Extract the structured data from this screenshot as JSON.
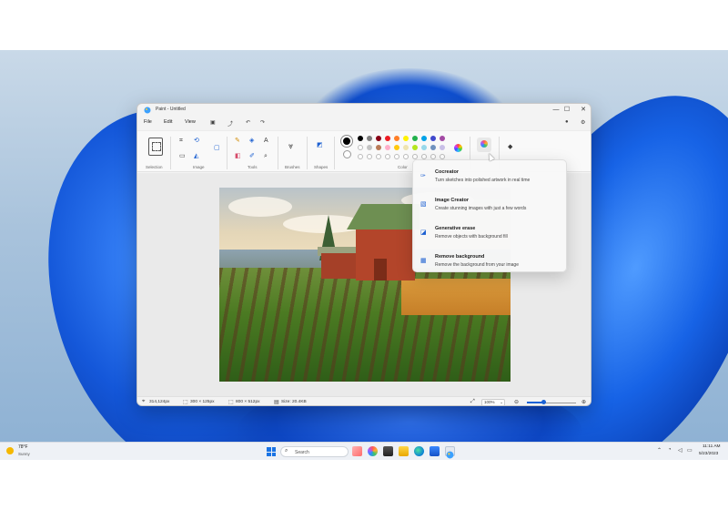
{
  "window": {
    "title": "Paint - Untitled",
    "controls": {
      "minimize": "—",
      "maximize": "☐",
      "close": "✕"
    }
  },
  "menubar": {
    "file": "File",
    "edit": "Edit",
    "view": "View"
  },
  "ribbon": {
    "groups": {
      "selection": "Selection",
      "image": "Image",
      "tools": "Tools",
      "brushes": "Brushes",
      "shapes": "Shapes",
      "color": "Color"
    },
    "palette": {
      "primary": "#000000",
      "row1": [
        "#000000",
        "#7f7f7f",
        "#880015",
        "#ed1c24",
        "#ff7f27",
        "#fff200",
        "#22b14c",
        "#00a2e8",
        "#3f48cc",
        "#a349a4"
      ],
      "row2": [
        "#ffffff",
        "#c3c3c3",
        "#b97a57",
        "#ffaec9",
        "#ffc90e",
        "#efe4b0",
        "#b5e61d",
        "#99d9ea",
        "#7092be",
        "#c8bfe7"
      ]
    }
  },
  "copilot_menu": {
    "items": [
      {
        "title": "Cocreator",
        "desc": "Turn sketches into polished artwork in real time"
      },
      {
        "title": "Image Creator",
        "desc": "Create stunning images with just a few words"
      },
      {
        "title": "Generative erase",
        "desc": "Remove objects with background fill"
      },
      {
        "title": "Remove background",
        "desc": "Remove the background from your image"
      }
    ]
  },
  "statusbar": {
    "cursor_pos": "314,124px",
    "selection_size": "300 × 125px",
    "canvas_size": "800 × 512px",
    "file_size": "Size: 20.4KB",
    "zoom": "100%",
    "zoom_level_fraction": 0.35
  },
  "taskbar": {
    "weather_temp": "78°F",
    "weather_desc": "Sunny",
    "search_placeholder": "Search",
    "clock_time": "11:11 AM",
    "clock_date": "5/23/2023"
  }
}
